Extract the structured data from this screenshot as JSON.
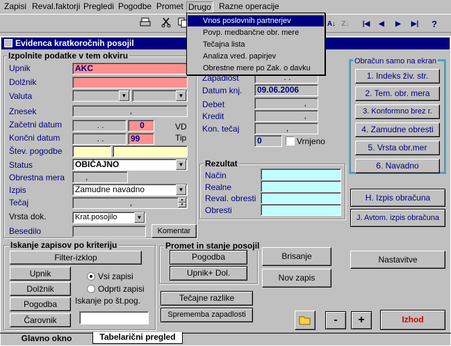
{
  "menu": {
    "items": [
      "Zapisi",
      "Reval.faktorji",
      "Pregledi",
      "Pogodbe",
      "Promet",
      "Drugo",
      "Razne operacije"
    ]
  },
  "dropdown": {
    "items": [
      "Vnos poslovnih partnerjev",
      "Povp. medbančne obr. mere",
      "Tečajna lista",
      "Analiza vred. papirjev",
      "Obrestne mere po Zak. o davku"
    ],
    "selected": 0
  },
  "toolbar": {
    "az_icon": "A↓",
    "za_icon": "Z↓",
    "first": "|◀",
    "prev": "◀",
    "next": "▶",
    "last": "▶|",
    "help": "?"
  },
  "window": {
    "title": "Evidenca kratkoročnih posojil"
  },
  "left": {
    "group_title": "Izpolnite podatke v tem okviru",
    "upnik_label": "Upnik",
    "upnik_value": "AKC",
    "dolznik_label": "Dolžnik",
    "valuta_label": "Valuta",
    "znesek_label": "Znesek",
    "znesek_value": ",",
    "zacetni_label": "Začetni datum",
    "zacetni_value": ". .",
    "zacetni_days": "0",
    "vd_label": "VD",
    "koncni_label": "Končni datum",
    "koncni_value": ". .",
    "koncni_days": "99",
    "tip_label": "Tip",
    "stev_label": "Štev. pogodbe",
    "status_label": "Status",
    "status_value": "OBIČAJNO",
    "obrestna_label": "Obrestna mera",
    "obrestna_value": ",",
    "izpis_label": "Izpis",
    "izpis_value": "Zamudne navadno",
    "tecaj_label": "Tečaj",
    "tecaj_value": ",",
    "vrsta_label": "Vrsta dok.",
    "vrsta_value": "Krat.posojilo",
    "besedilo_label": "Besedilo",
    "komentar_label": "Komentar"
  },
  "middle": {
    "zapadlost_label": "Zapadlost",
    "zapadlost_value": ". .",
    "datumknj_label": "Datum knj.",
    "datumknj_value": "09.06.2006",
    "debet_label": "Debet",
    "kredit_label": "Kredit",
    "kontecaj_label": "Kon. tečaj",
    "debet_value": ",",
    "kredit_value": ",",
    "kontecaj_value": ",",
    "num_value": "0",
    "vrnjeno_label": "Vrnjeno"
  },
  "rezultat": {
    "title": "Rezultat",
    "nacin": "Način",
    "realne": "Realne",
    "reval": "Reval. obresti",
    "obresti": "Obresti"
  },
  "obracun": {
    "title": "Obračun  samo na ekran",
    "buttons": [
      "1. Indeks živ. str.",
      "2. Tem. obr. mera",
      "3. Konformno brez r.",
      "4. Zamudne obresti",
      "5. Vrsta obr.mer",
      "6. Navadno"
    ]
  },
  "right_buttons": {
    "izpis": "H. Izpis obračuna",
    "avtom": "J. Avtom. izpis obračuna",
    "nastavitve": "Nastavitve",
    "izhod": "Izhod",
    "minus": "-",
    "plus": "+"
  },
  "iskanje": {
    "title": "Iskanje zapisov po kriteriju",
    "filter": "Filter-izklop",
    "upnik": "Upnik",
    "dolznik": "Dolžnik",
    "pogodba": "Pogodba",
    "carovnik": "Čarovnik",
    "vsi": "Vsi zapisi",
    "odprti": "Odprti zapisi",
    "po_st": "Iskanje po št.pog."
  },
  "promet": {
    "title": "Promet in stanje posojil",
    "pogodba": "Pogodba",
    "upnik_dol": "Upnik+ Dol.",
    "tecajne": "Tečajne razlike",
    "sprememba": "Sprememba zapadlosti"
  },
  "actions": {
    "brisanje": "Brisanje",
    "nov": "Nov zapis"
  },
  "tabs": {
    "glavno": "Glavno okno",
    "tabelaricni": "Tabelarični pregled"
  },
  "colors": {
    "accent": "#000080",
    "pink": "#ff9090",
    "yellow": "#ffffc0",
    "cyan": "#c0ffff",
    "obracun_border": "#00c0ff"
  }
}
